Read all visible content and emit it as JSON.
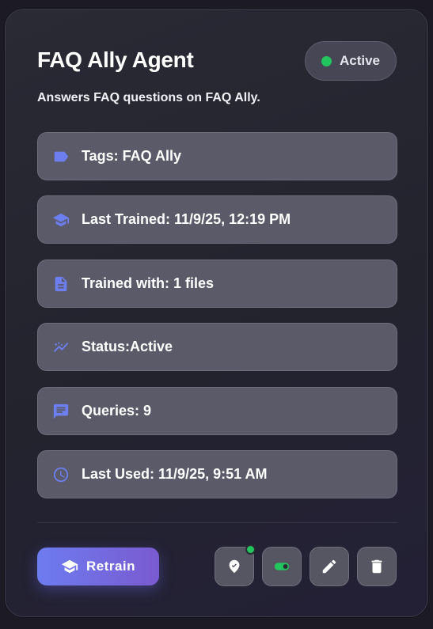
{
  "agent": {
    "title": "FAQ Ally Agent",
    "status_badge": "Active",
    "description": "Answers FAQ questions on FAQ Ally."
  },
  "details": [
    {
      "icon": "tag-icon",
      "text": "Tags: FAQ Ally"
    },
    {
      "icon": "graduation-cap-icon",
      "text": "Last Trained: 11/9/25, 12:19 PM"
    },
    {
      "icon": "document-icon",
      "text": "Trained with: 1 files"
    },
    {
      "icon": "trend-line-icon",
      "text": "Status:Active"
    },
    {
      "icon": "chat-bubble-icon",
      "text": "Queries: 9"
    },
    {
      "icon": "clock-icon",
      "text": "Last Used: 11/9/25, 9:51 AM"
    }
  ],
  "actions": {
    "retrain_label": "Retrain",
    "icons": [
      "location-pin-icon",
      "toggle-icon",
      "pencil-icon",
      "trash-icon"
    ]
  },
  "colors": {
    "accent": "#6d7ff0",
    "status_green": "#22c55e"
  }
}
